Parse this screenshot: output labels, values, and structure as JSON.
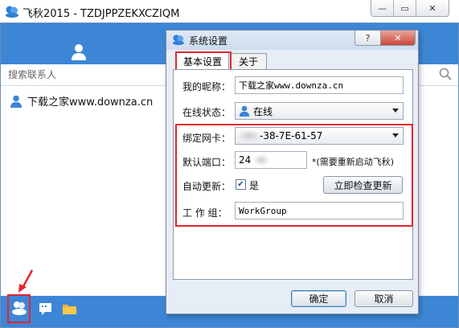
{
  "app": {
    "title": "飞秋2015 - TZDJPPZEKXCZIQM",
    "window_buttons": {
      "minimize": "—",
      "restore": "▭",
      "close": "✕"
    }
  },
  "search": {
    "placeholder": "搜索联系人"
  },
  "contacts": [
    {
      "name": "下载之家www.downza.cn"
    }
  ],
  "dialog": {
    "title": "系统设置",
    "help": "?",
    "close": "✕",
    "tabs": [
      {
        "label": "基本设置",
        "active": true
      },
      {
        "label": "关于",
        "active": false
      }
    ],
    "fields": {
      "nickname": {
        "label": "我的昵称：",
        "value": "下载之家www.downza.cn"
      },
      "status": {
        "label": "在线状态：",
        "value": "在线"
      },
      "nic": {
        "label": "绑定网卡：",
        "value": "-38-7E-61-57"
      },
      "port": {
        "label": "默认端口：",
        "value": "24",
        "note": "*(需要重新启动飞秋)"
      },
      "auto_update": {
        "label": "自动更新：",
        "checked": true,
        "check_label": "是",
        "button": "立即检查更新"
      },
      "workgroup": {
        "label": "工 作 组：",
        "value": "WorkGroup"
      }
    },
    "ok": "确定",
    "cancel": "取消"
  },
  "colors": {
    "brand_blue": "#3d86d6",
    "highlight_red": "#e3262d",
    "dialog_bg": "#e7edf6"
  },
  "icons": [
    "app-logo-icon",
    "user-icon",
    "search-icon",
    "contact-user-icon",
    "feiq-users-icon",
    "chat-icon",
    "folder-icon",
    "status-user-icon",
    "red-arrow-icon"
  ]
}
